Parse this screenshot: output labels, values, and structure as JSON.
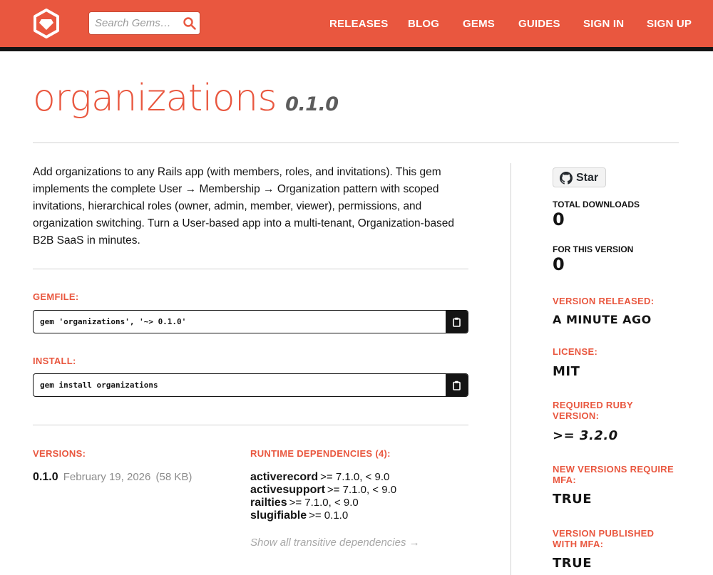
{
  "header": {
    "search_placeholder": "Search Gems…",
    "nav": [
      "RELEASES",
      "BLOG",
      "GEMS",
      "GUIDES",
      "SIGN IN",
      "SIGN UP"
    ]
  },
  "gem": {
    "name": "organizations",
    "version": "0.1.0",
    "description": "Add organizations to any Rails app (with members, roles, and invitations). This gem implements the complete User → Membership → Organization pattern with scoped invitations, hierarchical roles (owner, admin, member, viewer), permissions, and organization switching. Turn a User-based app into a multi-tenant, Organization-based B2B SaaS in minutes."
  },
  "gemfile": {
    "label": "GEMFILE:",
    "code": "gem 'organizations', '~> 0.1.0'"
  },
  "install": {
    "label": "INSTALL:",
    "code": "gem install organizations"
  },
  "versions": {
    "label": "VERSIONS:",
    "items": [
      {
        "number": "0.1.0",
        "date": "February 19, 2026",
        "size": "(58 KB)"
      }
    ]
  },
  "dependencies": {
    "label": "RUNTIME DEPENDENCIES (4):",
    "items": [
      {
        "name": "activerecord",
        "requirement": ">= 7.1.0, < 9.0"
      },
      {
        "name": "activesupport",
        "requirement": ">= 7.1.0, < 9.0"
      },
      {
        "name": "railties",
        "requirement": ">= 7.1.0, < 9.0"
      },
      {
        "name": "slugifiable",
        "requirement": ">= 0.1.0"
      }
    ],
    "show_all": "Show all transitive dependencies →"
  },
  "sidebar": {
    "star_label": "Star",
    "total_downloads_label": "TOTAL DOWNLOADS",
    "total_downloads": "0",
    "this_version_label": "FOR THIS VERSION",
    "this_version": "0",
    "released_label": "VERSION RELEASED:",
    "released": "A MINUTE AGO",
    "license_label": "LICENSE:",
    "license": "MIT",
    "ruby_label": "REQUIRED RUBY VERSION:",
    "ruby": ">= 3.2.0",
    "mfa_required_label": "NEW VERSIONS REQUIRE MFA:",
    "mfa_required": "TRUE",
    "mfa_published_label": "VERSION PUBLISHED WITH MFA:",
    "mfa_published": "TRUE"
  },
  "colors": {
    "brand": "#e9573f",
    "dark": "#141414",
    "muted": "#8c8c8c"
  }
}
